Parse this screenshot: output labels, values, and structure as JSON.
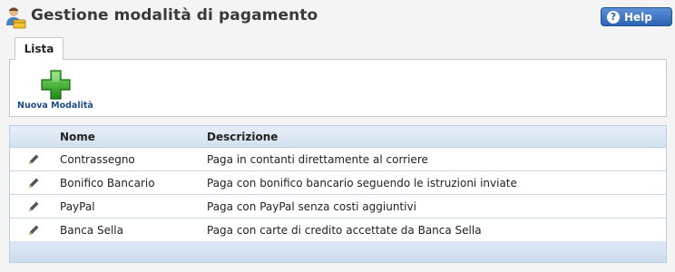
{
  "header": {
    "title": "Gestione modalità di pagamento",
    "app_icon": "user-payment-icon",
    "help_label": "Help",
    "help_icon": "question-circle-icon",
    "help_icon_glyph": "?"
  },
  "tabs": [
    {
      "label": "Lista",
      "selected": true
    }
  ],
  "toolbar": {
    "new_label": "Nuova Modalità",
    "new_icon": "green-plus-icon"
  },
  "table": {
    "columns": {
      "name": "Nome",
      "description": "Descrizione"
    },
    "rows": [
      {
        "name": "Contrassegno",
        "description": "Paga in contanti direttamente al corriere",
        "edit_icon": "pencil-icon"
      },
      {
        "name": "Bonifico Bancario",
        "description": "Paga con bonifico bancario seguendo le istruzioni inviate",
        "edit_icon": "pencil-icon"
      },
      {
        "name": "PayPal",
        "description": "Paga con PayPal senza costi aggiuntivi",
        "edit_icon": "pencil-icon"
      },
      {
        "name": "Banca Sella",
        "description": "Paga con carte di credito accettate da Banca Sella",
        "edit_icon": "pencil-icon"
      }
    ]
  },
  "colors": {
    "help_button": "#2c63b4",
    "plus_green": "#2e9e1f",
    "grid_header": "#d3e1f0",
    "link_blue": "#1e4d86"
  }
}
